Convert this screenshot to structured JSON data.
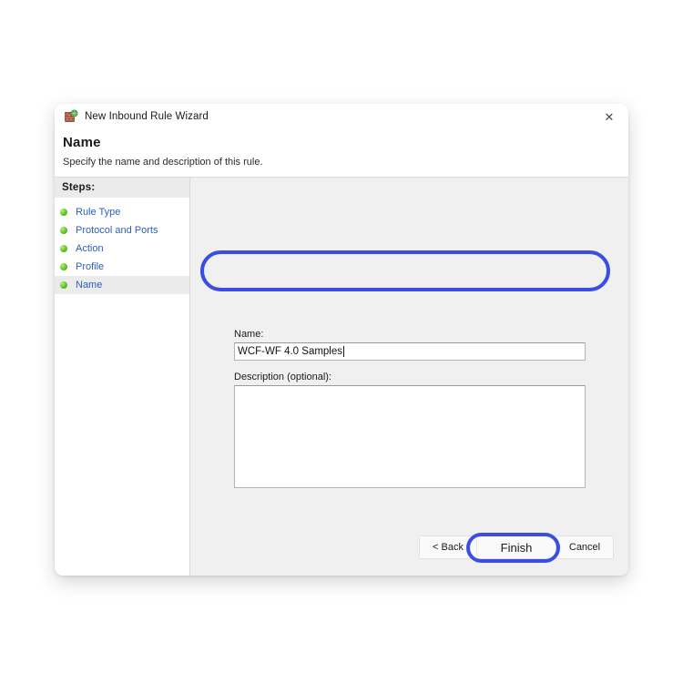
{
  "window": {
    "title": "New Inbound Rule Wizard",
    "icon": "firewall-brick-wall-icon",
    "close_label": "✕"
  },
  "header": {
    "title": "Name",
    "subtitle": "Specify the name and description of this rule."
  },
  "sidebar": {
    "header": "Steps:",
    "items": [
      {
        "label": "Rule Type",
        "selected": false
      },
      {
        "label": "Protocol and Ports",
        "selected": false
      },
      {
        "label": "Action",
        "selected": false
      },
      {
        "label": "Profile",
        "selected": false
      },
      {
        "label": "Name",
        "selected": true
      }
    ]
  },
  "form": {
    "name_label": "Name:",
    "name_value": "WCF-WF 4.0 Samples",
    "name_placeholder": "",
    "description_label": "Description (optional):",
    "description_value": "",
    "description_placeholder": ""
  },
  "footer": {
    "back_label": "< Back",
    "finish_label": "Finish",
    "cancel_label": "Cancel"
  },
  "annotations": {
    "color": "#3a4ee3",
    "targets": [
      "name-input",
      "finish-button"
    ]
  },
  "colors": {
    "page_background": "#ffffff",
    "dialog_background": "#ffffff",
    "content_background": "#f0f0f0",
    "step_link": "#2b5fb8",
    "step_bullet": "#6fcc33",
    "selected_row": "#ebebeb",
    "annotation_blue": "#3a4ee3"
  }
}
